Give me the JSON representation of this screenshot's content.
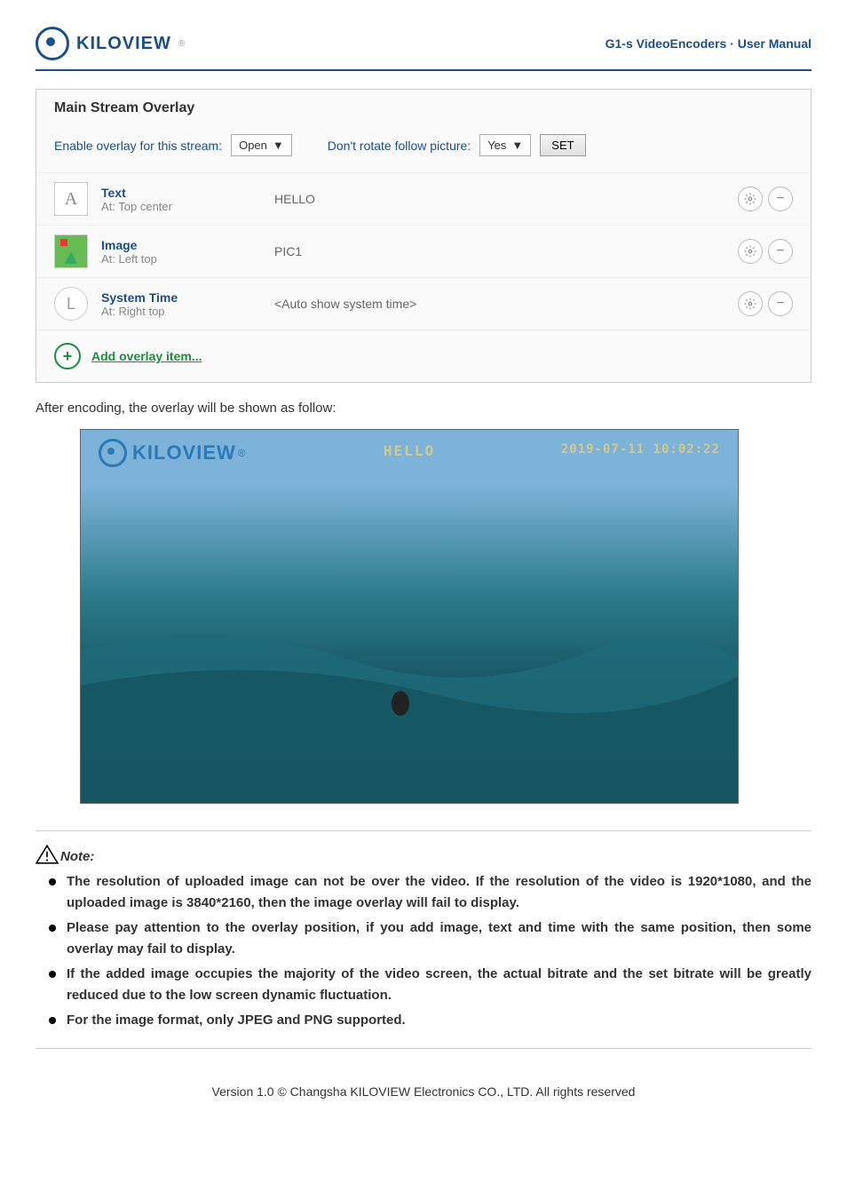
{
  "header": {
    "brand": "KILOVIEW",
    "title": "G1-s VideoEncoders · User Manual"
  },
  "panel": {
    "title": "Main Stream Overlay",
    "enable_label": "Enable overlay for this stream:",
    "enable_value": "Open",
    "rotate_label": "Don't rotate follow picture:",
    "rotate_value": "Yes",
    "set_button": "SET",
    "items": [
      {
        "type": "Text",
        "position": "At: Top center",
        "value": "HELLO",
        "icon": "text-a"
      },
      {
        "type": "Image",
        "position": "At: Left top",
        "value": "PIC1",
        "icon": "image-i"
      },
      {
        "type": "System Time",
        "position": "At: Right top",
        "value": "<Auto show system time>",
        "icon": "clock"
      }
    ],
    "add_link": "Add overlay item..."
  },
  "body": {
    "after_encoding": "After encoding, the overlay will be shown as follow:"
  },
  "preview": {
    "logo_text": "KILOVIEW",
    "center_text": "HELLO",
    "timestamp": "2019-07-11 10:02:22"
  },
  "note": {
    "label": "Note:",
    "items": [
      "The resolution of uploaded image can not be over the video. If the resolution of the video is 1920*1080, and the uploaded image is 3840*2160, then the image overlay will fail to display.",
      "Please pay attention to the overlay position, if you add image, text and time with the same position, then some overlay may fail to display.",
      "If the added image occupies the majority of the video screen, the actual bitrate and the set bitrate will be greatly reduced due to the low screen dynamic fluctuation.",
      "For the image format, only JPEG and PNG supported."
    ]
  },
  "footer": "Version 1.0 © Changsha KILOVIEW Electronics CO., LTD. All rights reserved"
}
